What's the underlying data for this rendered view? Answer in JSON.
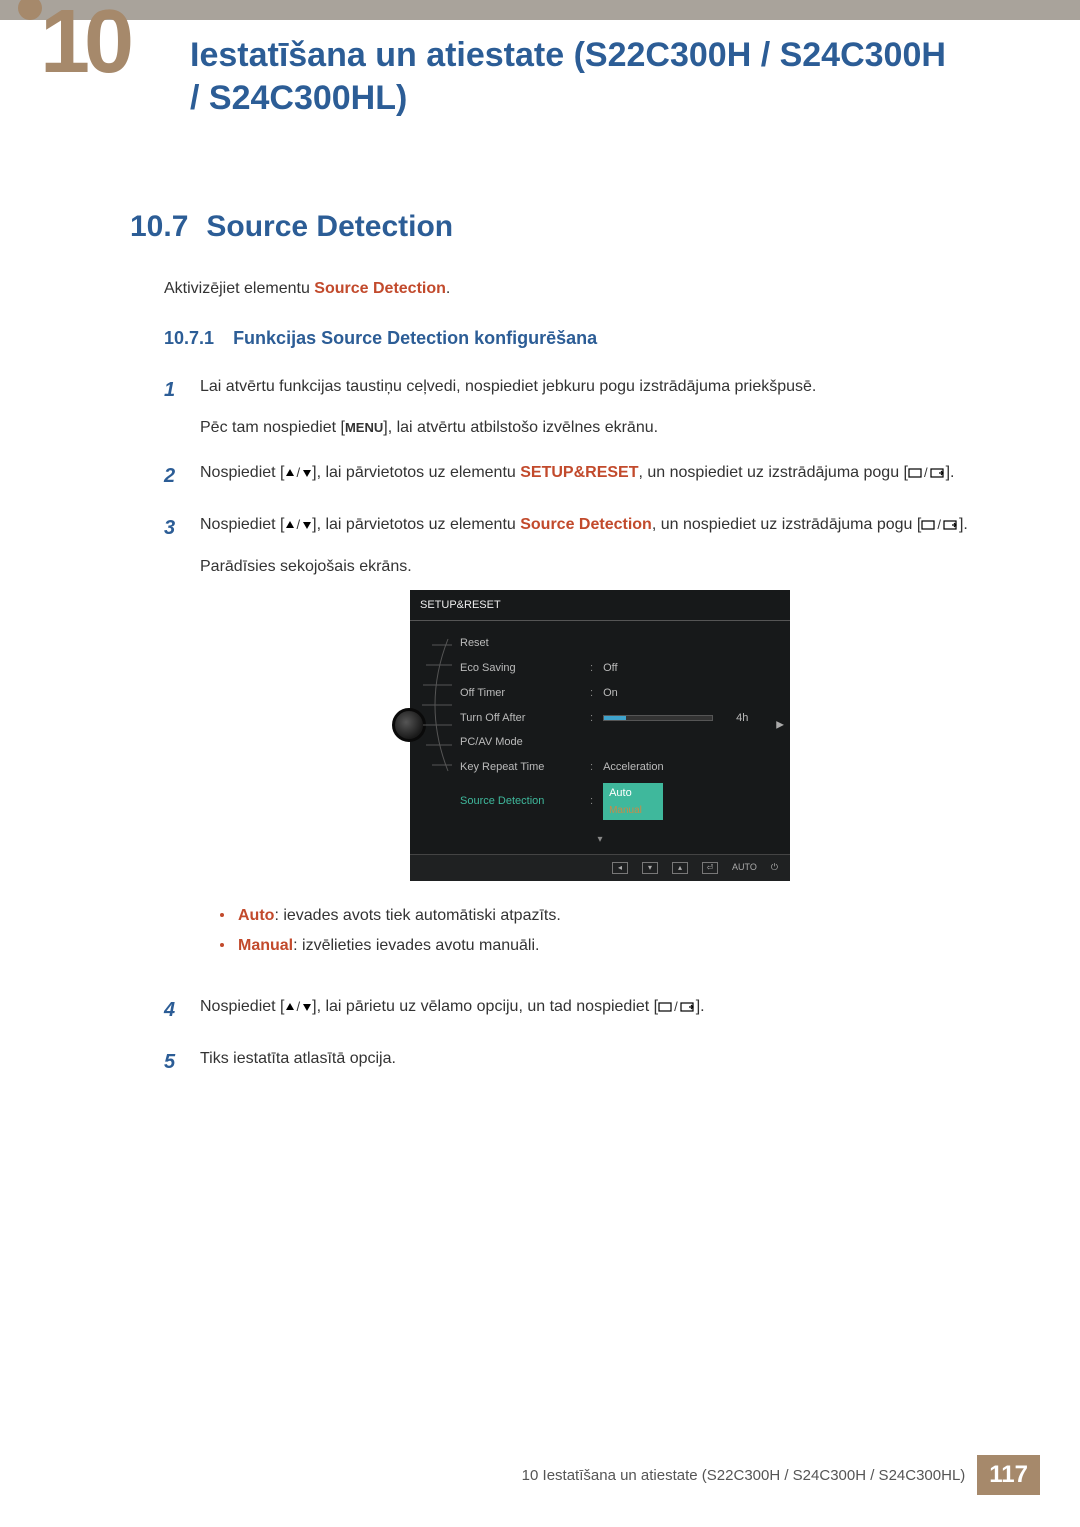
{
  "header": {
    "chapter_number": "10",
    "title": "Iestatīšana un atiestate (S22C300H / S24C300H / S24C300HL)"
  },
  "section": {
    "number": "10.7",
    "title": "Source Detection",
    "intro_prefix": "Aktivizējiet elementu ",
    "intro_hl": "Source Detection",
    "intro_suffix": "."
  },
  "subsection": {
    "number": "10.7.1",
    "title": "Funkcijas Source Detection konfigurēšana"
  },
  "steps": {
    "s1": {
      "num": "1",
      "line1": "Lai atvērtu funkcijas taustiņu ceļvedi, nospiediet jebkuru pogu izstrādājuma priekšpusē.",
      "line2a": "Pēc tam nospiediet [",
      "menu_glyph": "MENU",
      "line2b": "], lai atvērtu atbilstošo izvēlnes ekrānu."
    },
    "s2": {
      "num": "2",
      "a": "Nospiediet [",
      "b": "], lai pārvietotos uz elementu ",
      "hl": "SETUP&RESET",
      "c": ", un nospiediet uz izstrādājuma pogu [",
      "d": "]."
    },
    "s3": {
      "num": "3",
      "a": "Nospiediet [",
      "b": "], lai pārvietotos uz elementu ",
      "hl": "Source Detection",
      "c": ", un nospiediet uz izstrādājuma pogu [",
      "d": "].",
      "e": "Parādīsies sekojošais ekrāns."
    },
    "s4": {
      "num": "4",
      "a": "Nospiediet [",
      "b": "], lai pārietu uz vēlamo opciju, un tad nospiediet [",
      "c": "]."
    },
    "s5": {
      "num": "5",
      "text": "Tiks iestatīta atlasītā opcija."
    }
  },
  "bullets": {
    "auto_label": "Auto",
    "auto_text": ": ievades avots tiek automātiski atpazīts.",
    "manual_label": "Manual",
    "manual_text": ": izvēlieties ievades avotu manuāli."
  },
  "osd": {
    "title": "SETUP&RESET",
    "rows": {
      "reset": "Reset",
      "eco": "Eco Saving",
      "eco_val": "Off",
      "off_timer": "Off Timer",
      "off_timer_val": "On",
      "turn_off": "Turn Off After",
      "turn_off_val": "4h",
      "pcav": "PC/AV Mode",
      "key_repeat": "Key Repeat Time",
      "key_repeat_val": "Acceleration",
      "source": "Source Detection",
      "source_val": "Auto",
      "source_val2": "Manual"
    },
    "footer_auto": "AUTO"
  },
  "footer": {
    "text": "10 Iestatīšana un atiestate (S22C300H / S24C300H / S24C300HL)",
    "page": "117"
  }
}
